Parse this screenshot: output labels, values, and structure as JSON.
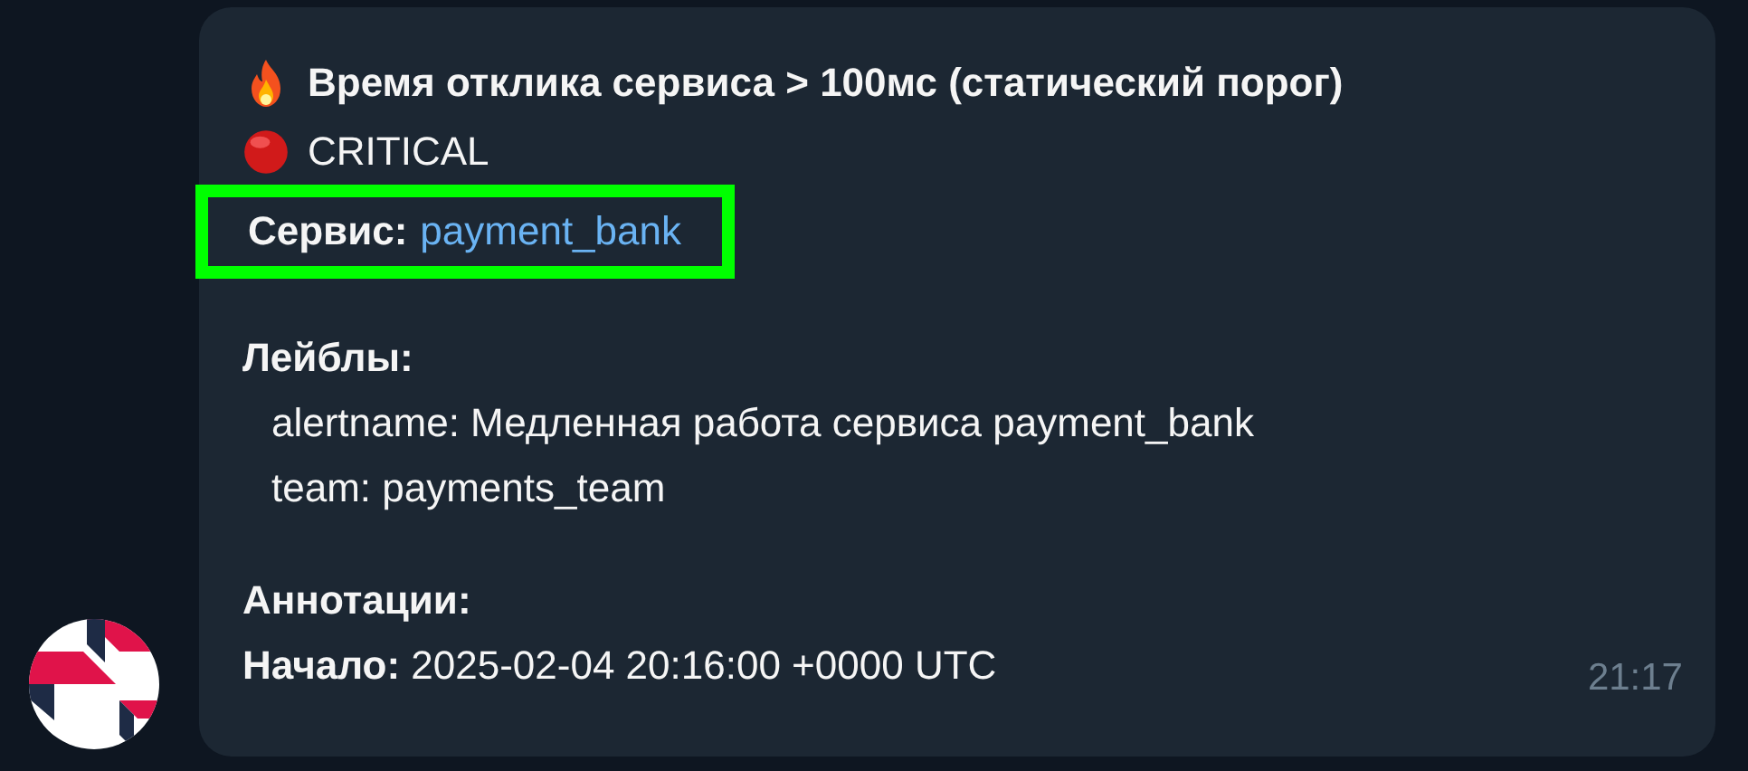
{
  "message": {
    "title": "Время отклика сервиса > 100мс (статический порог)",
    "severity": "CRITICAL",
    "service": {
      "label": "Сервис:",
      "value": "payment_bank",
      "highlighted": true
    },
    "labels_heading": "Лейблы:",
    "labels": [
      {
        "key": "alertname:",
        "value": "Медленная работа сервиса payment_bank"
      },
      {
        "key": "team:",
        "value": "payments_team"
      }
    ],
    "annotations_heading": "Аннотации:",
    "start": {
      "label": "Начало:",
      "value": "2025-02-04 20:16:00 +0000 UTC"
    },
    "time": "21:17"
  }
}
